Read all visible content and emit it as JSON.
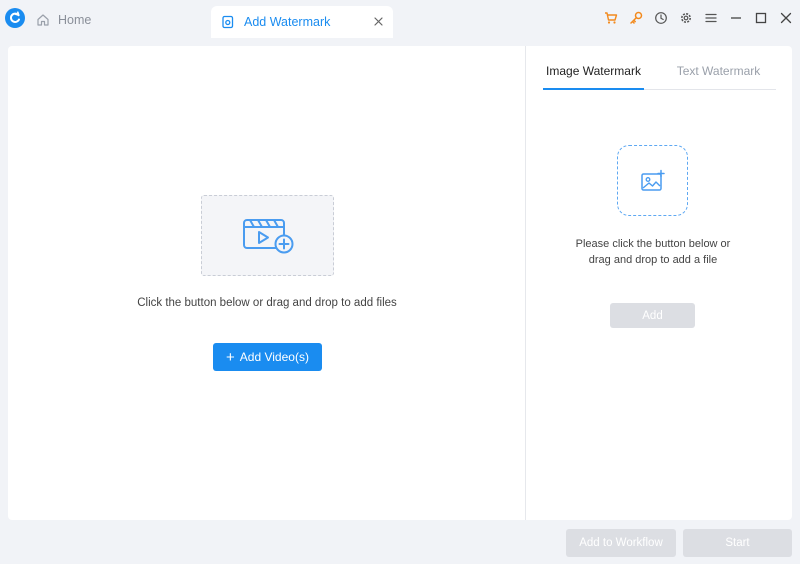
{
  "titlebar": {
    "home_tab": "Home",
    "active_tab": "Add Watermark",
    "icons": [
      "cart-icon",
      "key-icon",
      "history-icon",
      "settings-icon",
      "menu-icon",
      "minimize-icon",
      "maximize-icon",
      "close-icon"
    ],
    "accent_orange": "#f28a1e"
  },
  "left": {
    "hint": "Click the button below or drag and drop to add files",
    "add_videos_label": "Add Video(s)"
  },
  "right": {
    "tabs": [
      "Image Watermark",
      "Text Watermark"
    ],
    "active_tab_index": 0,
    "hint_line1": "Please click the button below or",
    "hint_line2": "drag and drop to add a file",
    "add_label": "Add"
  },
  "footer": {
    "workflow_label": "Add to Workflow",
    "start_label": "Start"
  },
  "colors": {
    "accent": "#1a8cf0",
    "disabled": "#dcdee3",
    "background": "#f1f3f7"
  }
}
